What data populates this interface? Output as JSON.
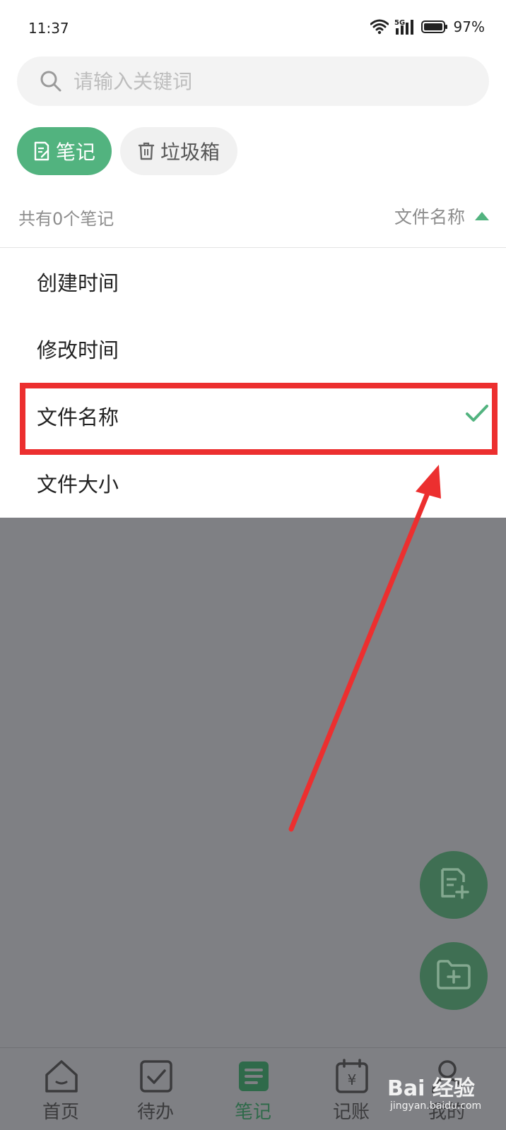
{
  "status_bar": {
    "time": "11:37",
    "battery": "97%",
    "network": "5G",
    "icons": [
      "wifi-icon",
      "signal-5g-icon",
      "battery-icon"
    ]
  },
  "search": {
    "placeholder": "请输入关键词",
    "value": ""
  },
  "tabs": [
    {
      "label": "笔记",
      "icon": "note-icon",
      "active": true
    },
    {
      "label": "垃圾箱",
      "icon": "trash-icon",
      "active": false
    }
  ],
  "list_header": {
    "count_text": "共有0个笔记",
    "sort_label": "文件名称",
    "sort_direction": "ascending"
  },
  "sort_menu": {
    "options": [
      {
        "label": "创建时间",
        "selected": false
      },
      {
        "label": "修改时间",
        "selected": false
      },
      {
        "label": "文件名称",
        "selected": true
      },
      {
        "label": "文件大小",
        "selected": false
      }
    ]
  },
  "fabs": [
    {
      "icon": "add-note-icon"
    },
    {
      "icon": "add-folder-icon"
    }
  ],
  "bottom_nav": [
    {
      "label": "首页",
      "icon": "home-icon",
      "active": false
    },
    {
      "label": "待办",
      "icon": "todo-icon",
      "active": false
    },
    {
      "label": "笔记",
      "icon": "notes-icon",
      "active": true
    },
    {
      "label": "记账",
      "icon": "ledger-icon",
      "active": false
    },
    {
      "label": "我的",
      "icon": "profile-icon",
      "active": false
    }
  ],
  "watermark": {
    "brand": "Bai 经验",
    "url": "jingyan.baidu.com"
  },
  "colors": {
    "accent": "#52b37f",
    "highlight": "#ec2f2f",
    "overlay": "#7f8084",
    "fab": "#3f6f53"
  }
}
